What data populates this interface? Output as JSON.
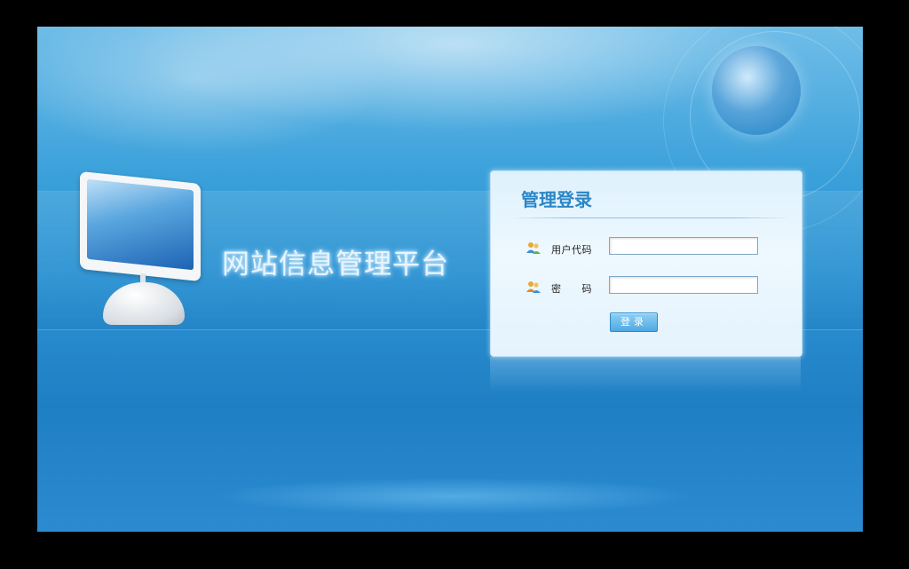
{
  "site": {
    "title": "网站信息管理平台"
  },
  "login": {
    "title": "管理登录",
    "username_label": "用户代码",
    "username_value": "",
    "password_label": "密　　码",
    "password_value": "",
    "button_label": "登录"
  },
  "icons": {
    "user": "user-group-icon",
    "password": "user-group-icon"
  },
  "colors": {
    "accent": "#2a86c7",
    "background": "#2a8fd0",
    "button": "#4ea9e3"
  }
}
